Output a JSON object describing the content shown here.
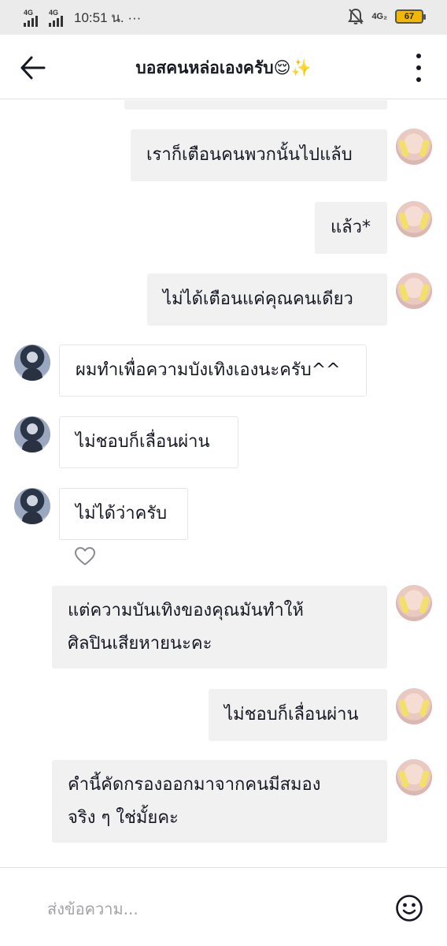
{
  "status_bar": {
    "network_1": "4G",
    "network_2": "4G",
    "time": "10:51 น. ···",
    "network_right": "4G₂",
    "battery": "67"
  },
  "header": {
    "title": "บอสคนหล่อเองครับ😌✨"
  },
  "messages": [
    {
      "sender": "me",
      "lines": [
        "เราก็เตือนคนพวกนั้นไปแล้บ"
      ]
    },
    {
      "sender": "me",
      "lines": [
        "แล้ว*"
      ]
    },
    {
      "sender": "me",
      "lines": [
        "ไม่ได้เตือนแค่คุณคนเดียว"
      ]
    },
    {
      "sender": "other",
      "lines": [
        "ผมทำเพื่อความบังเทิงเองนะครับ^^"
      ]
    },
    {
      "sender": "other",
      "lines": [
        "ไม่ชอบก็เลื่อนผ่าน"
      ]
    },
    {
      "sender": "other",
      "lines": [
        "ไม่ได้ว่าครับ"
      ]
    },
    {
      "sender": "me",
      "lines": [
        "แต่ความบันเทิงของคุณมันทำให้",
        "ศิลปินเสียหายนะคะ"
      ]
    },
    {
      "sender": "me",
      "lines": [
        "ไม่ชอบก็เลื่อนผ่าน"
      ]
    },
    {
      "sender": "me",
      "lines": [
        "คำนี้คัดกรองออกมาจากคนมีสมอง",
        "จริง ๆ ใช่มั้ยคะ"
      ]
    }
  ],
  "composer": {
    "placeholder": "ส่งข้อความ..."
  },
  "icons": {
    "back": "arrow-left-icon",
    "more": "more-vertical-icon",
    "like": "heart-outline-icon",
    "emoji": "smiley-icon"
  },
  "colors": {
    "my_bubble": "#f1f1f2",
    "their_bubble": "#ffffff",
    "text": "#161823",
    "placeholder": "#a2a3a8",
    "status_bar": "#ebebeb",
    "battery": "#f2b705"
  }
}
